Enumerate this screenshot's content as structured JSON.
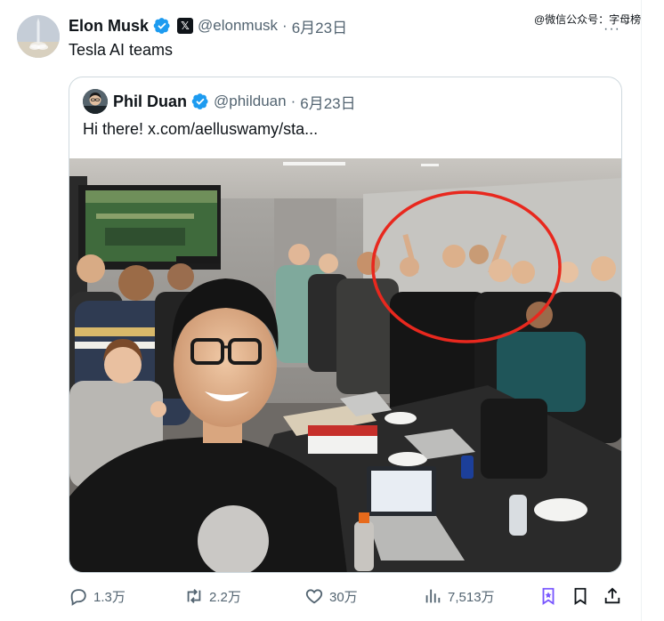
{
  "tweet": {
    "author_name": "Elon Musk",
    "handle": "@elonmusk",
    "separator": "·",
    "date": "6月23日",
    "text": "Tesla AI teams",
    "more": "···",
    "x_badge": "𝕏"
  },
  "watermark": "@微信公众号：字母榜",
  "quoted": {
    "author_name": "Phil Duan",
    "handle": "@philduan",
    "separator": "·",
    "date": "6月23日",
    "text": "Hi there!  x.com/aelluswamy/sta..."
  },
  "actions": {
    "replies": "1.3万",
    "reposts": "2.2万",
    "likes": "30万",
    "views": "7,513万"
  },
  "colors": {
    "verified": "#1d9bf0",
    "text": "#0f1419",
    "muted": "#536471",
    "border": "#cfd9de",
    "bookmark_accent": "#7856ff",
    "highlight_circle": "#e8281e"
  }
}
